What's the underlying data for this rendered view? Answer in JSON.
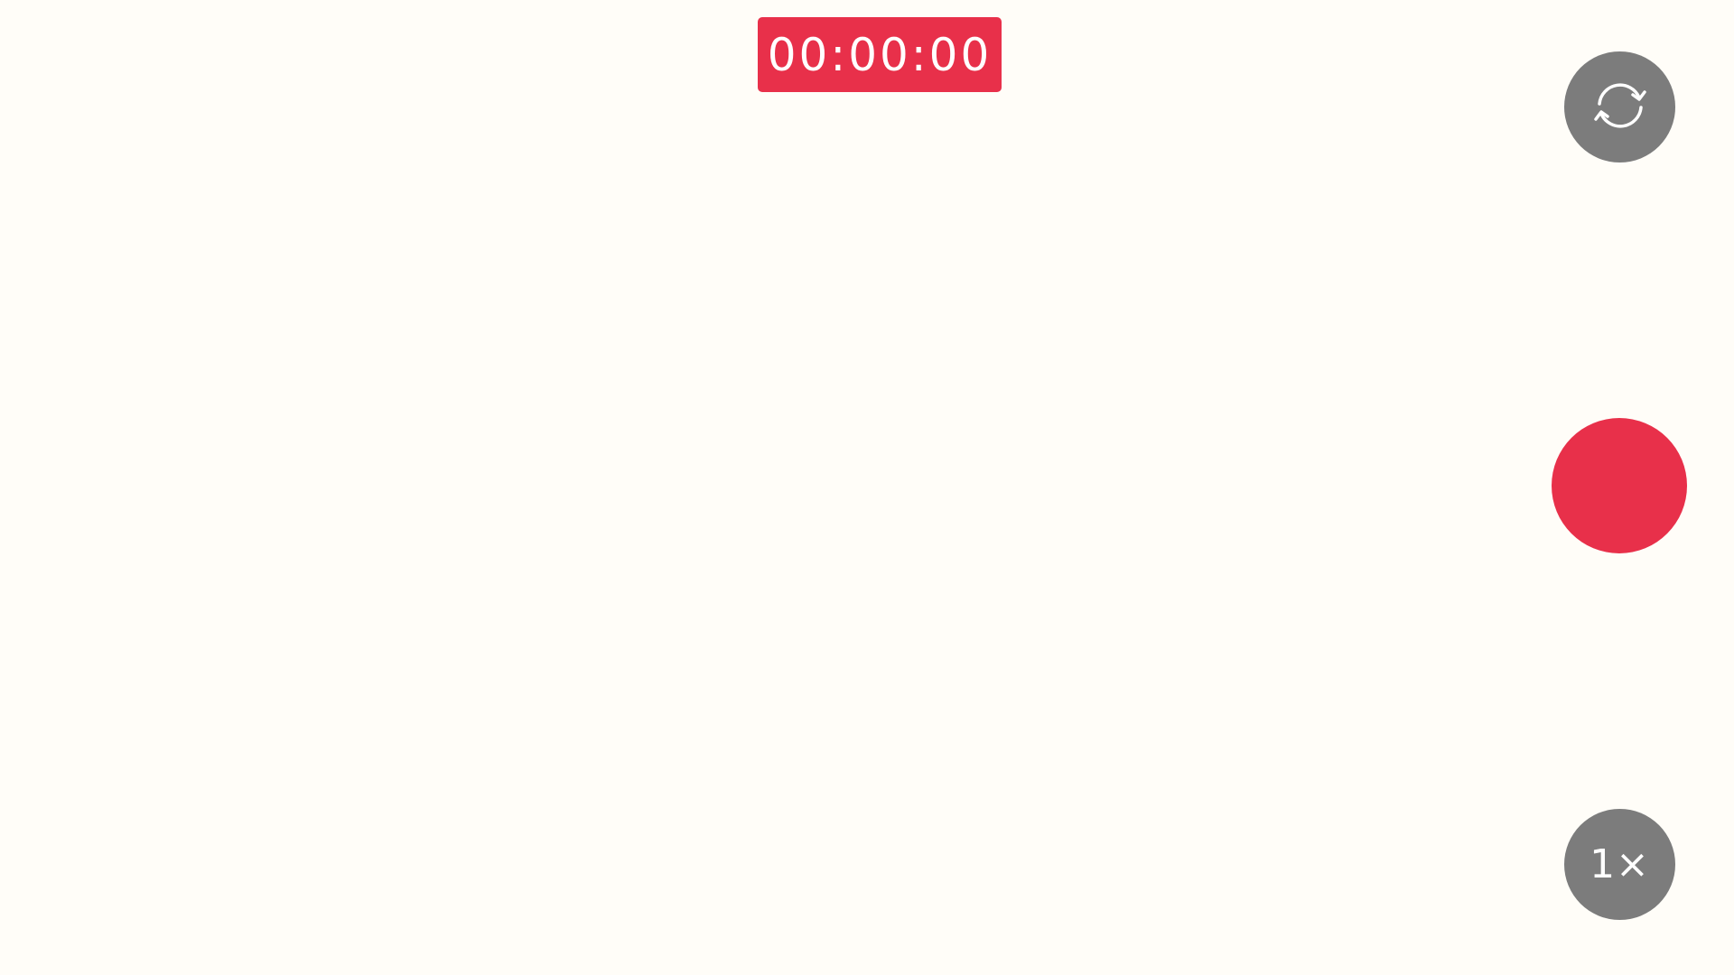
{
  "timer": {
    "text": "00:00:00"
  },
  "controls": {
    "switch_camera": {
      "icon": "switch-camera-icon"
    },
    "record": {
      "icon": "record-icon"
    },
    "zoom": {
      "label": "1×"
    }
  },
  "colors": {
    "background": "#fffdf8",
    "accent_red": "#e8304a",
    "control_gray": "#7c7c7c",
    "control_text": "#ffffff"
  }
}
